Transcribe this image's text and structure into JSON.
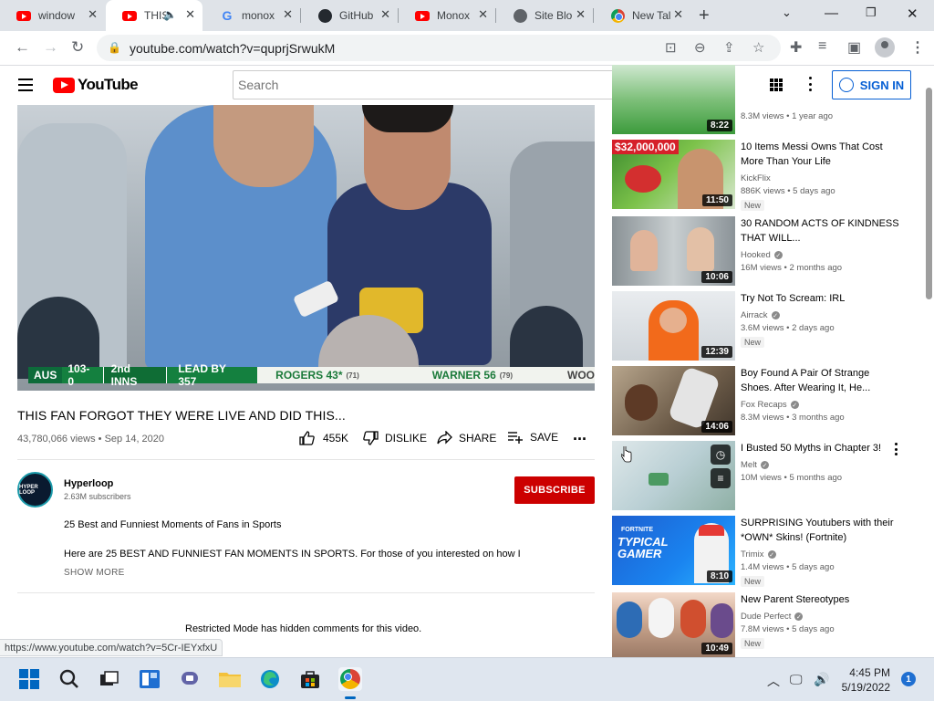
{
  "browser": {
    "tabs": [
      {
        "label": "window",
        "icon": "youtube-icon"
      },
      {
        "label": "THIS",
        "icon": "youtube-icon",
        "active": true
      },
      {
        "label": "monox",
        "icon": "google-icon"
      },
      {
        "label": "GitHub",
        "icon": "github-icon"
      },
      {
        "label": "Monox",
        "icon": "youtube-icon"
      },
      {
        "label": "Site Blo",
        "icon": "globe-icon"
      },
      {
        "label": "New Tal",
        "icon": "chrome-icon"
      }
    ],
    "url": "youtube.com/watch?v=quprjSrwukM"
  },
  "masthead": {
    "logo_text": "YouTube",
    "search_placeholder": "Search",
    "signin_label": "SIGN IN"
  },
  "player": {
    "score": {
      "team": "AUS",
      "runs": "103-0",
      "innings": "2nd INNS",
      "lead": "LEAD BY 357",
      "p1_name": "ROGERS 43*",
      "p1_balls": "(71)",
      "p2_name": "WARNER 56",
      "p2_balls": "(79)",
      "p3_name": "WOO"
    }
  },
  "video": {
    "title": "THIS FAN FORGOT THEY WERE LIVE AND DID THIS...",
    "meta": "43,780,066 views • Sep 14, 2020",
    "likes": "455K",
    "dislike_label": "DISLIKE",
    "share_label": "SHARE",
    "save_label": "SAVE"
  },
  "channel": {
    "avatar_text": "HYPER LOOP",
    "name": "Hyperloop",
    "subs": "2.63M subscribers",
    "subscribe_label": "SUBSCRIBE"
  },
  "description": {
    "line1": "25 Best and Funniest Moments of Fans in Sports",
    "line2": "Here are 25 BEST AND FUNNIEST FAN MOMENTS IN SPORTS. For those of you interested on how I",
    "show_more": "SHOW MORE"
  },
  "comments": {
    "restricted": "Restricted Mode has hidden comments for this video."
  },
  "status_url": "https://www.youtube.com/watch?v=5Cr-IEYxfxU",
  "recommendations": [
    {
      "title": "",
      "channel": "",
      "stats": "8.3M views • 1 year ago",
      "duration": "8:22",
      "badge": ""
    },
    {
      "title": "10 Items Messi Owns That Cost More Than Your Life",
      "channel": "KickFlix",
      "stats": "886K views • 5 days ago",
      "duration": "11:50",
      "badge": "New",
      "thumb_text": "$32,000,000"
    },
    {
      "title": "30 RANDOM ACTS OF KINDNESS THAT WILL...",
      "channel": "Hooked",
      "stats": "16M views • 2 months ago",
      "duration": "10:06",
      "badge": ""
    },
    {
      "title": "Try Not To Scream: IRL",
      "channel": "Airrack",
      "stats": "3.6M views • 2 days ago",
      "duration": "12:39",
      "badge": "New"
    },
    {
      "title": "Boy Found A Pair Of Strange Shoes. After Wearing It, He...",
      "channel": "Fox Recaps",
      "stats": "8.3M views • 3 months ago",
      "duration": "14:06",
      "badge": ""
    },
    {
      "title": "I Busted 50 Myths in Chapter 3!",
      "channel": "Melt",
      "stats": "10M views • 5 months ago",
      "duration": "",
      "badge": ""
    },
    {
      "title": "SURPRISING Youtubers with their *OWN* Skins! (Fortnite)",
      "channel": "Trimix",
      "stats": "1.4M views • 5 days ago",
      "duration": "8:10",
      "badge": "New",
      "thumb_text": "TYPICAL GAMER",
      "thumb_sub": "FORTNITE"
    },
    {
      "title": "New Parent Stereotypes",
      "channel": "Dude Perfect",
      "stats": "7.8M views • 5 days ago",
      "duration": "10:49",
      "badge": "New"
    }
  ],
  "taskbar": {
    "time": "4:45 PM",
    "date": "5/19/2022",
    "notifications": "1"
  },
  "colors": {
    "youtube_red": "#ff0000",
    "subscribe_red": "#cc0000",
    "signin_blue": "#065fd4"
  }
}
